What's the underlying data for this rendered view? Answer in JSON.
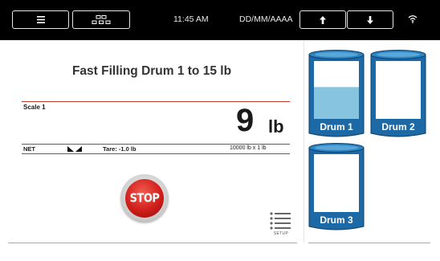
{
  "topbar": {
    "menu_icon": "hamburger-menu-icon",
    "grid_icon": "grid-icon",
    "time": "11:45 AM",
    "date": "DD/MM/AAAA",
    "up_icon": "arrow-up-icon",
    "down_icon": "arrow-down-icon",
    "wifi_icon": "wifi-icon"
  },
  "main": {
    "title": "Fast Filling Drum 1 to 15 lb",
    "scale_label": "Scale 1",
    "weight_value": "9",
    "weight_unit": "lb",
    "net_label": "NET",
    "tare_label": "Tare: -1.0 lb",
    "capacity_label": "10000 lb x 1 lb",
    "stop_label": "STOP",
    "setup_label": "SETUP"
  },
  "drums": [
    {
      "label": "Drum 1",
      "fill_fraction": 0.55
    },
    {
      "label": "Drum 2",
      "fill_fraction": 0
    },
    {
      "label": "Drum 3",
      "fill_fraction": 0
    }
  ],
  "colors": {
    "drum_blue": "#1c69a6",
    "drum_fill": "#86c4e0",
    "accent_red": "#c0392b",
    "stop_red": "#d11f1b"
  }
}
